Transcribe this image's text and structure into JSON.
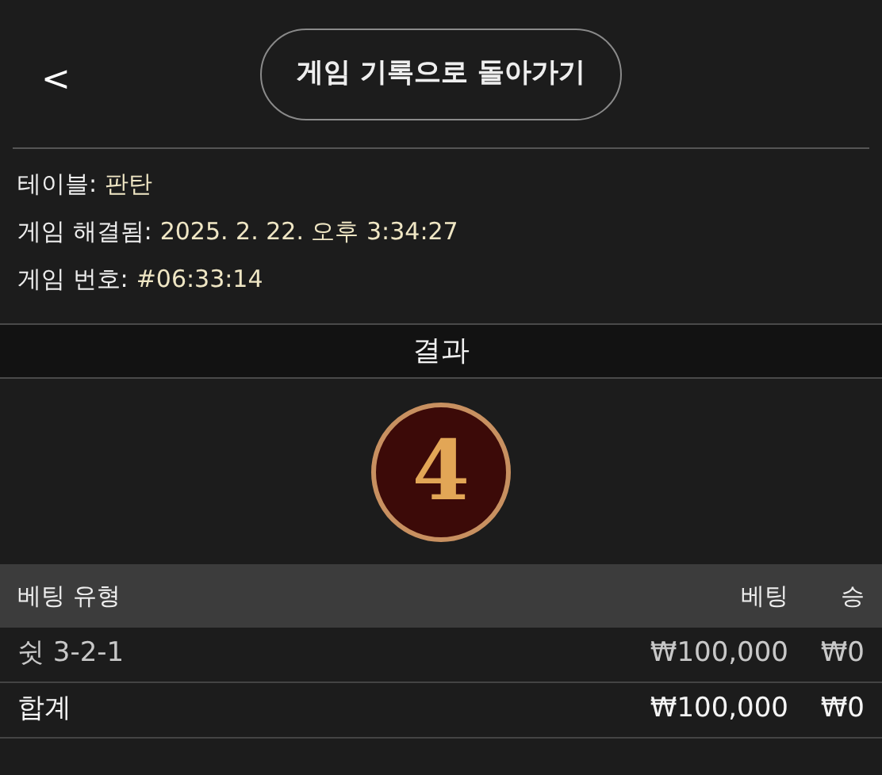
{
  "header": {
    "back_button": "<",
    "title_button": "게임 기록으로 돌아가기"
  },
  "info": [
    {
      "label": "테이블:",
      "value": "판탄"
    },
    {
      "label": "게임 해결됨:",
      "value": "2025. 2. 22. 오후 3:34:27"
    },
    {
      "label": "게임 번호:",
      "value": "#06:33:14"
    }
  ],
  "result": {
    "title": "결과",
    "number": "4"
  },
  "table": {
    "columns": [
      "베팅 유형",
      "베팅",
      "승"
    ],
    "rows": [
      {
        "kind": "bet",
        "cells": [
          "쉿 3-2-1",
          "₩100,000",
          "₩0"
        ]
      },
      {
        "kind": "total",
        "cells": [
          "합계",
          "₩100,000",
          "₩0"
        ]
      }
    ]
  }
}
